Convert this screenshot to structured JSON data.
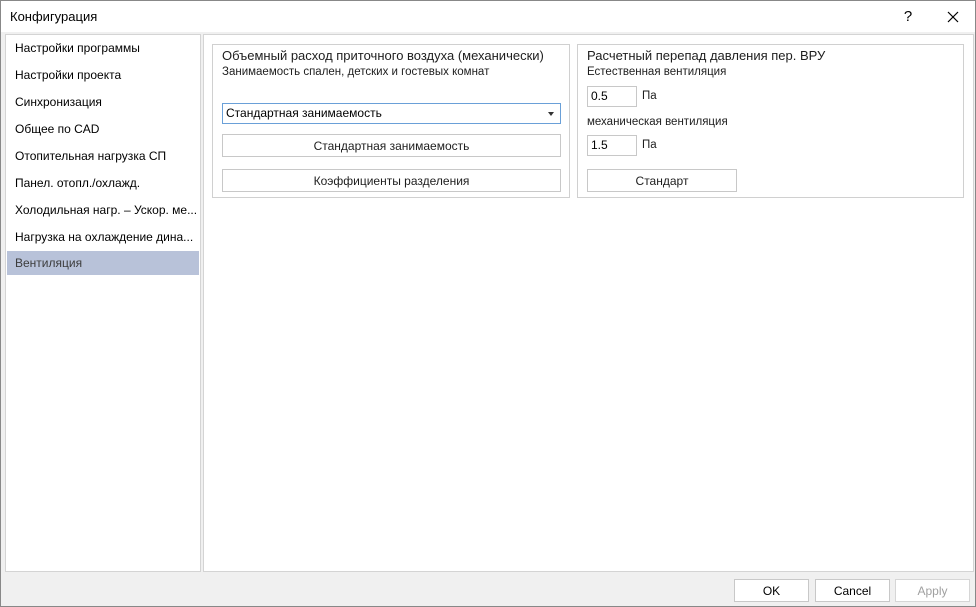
{
  "window": {
    "title": "Конфигурация",
    "help_label": "?"
  },
  "sidebar": {
    "items": [
      {
        "label": "Настройки программы",
        "selected": false
      },
      {
        "label": "Настройки проекта",
        "selected": false
      },
      {
        "label": "Синхронизация",
        "selected": false
      },
      {
        "label": "Общее по CAD",
        "selected": false
      },
      {
        "label": "Отопительная нагрузка СП",
        "selected": false
      },
      {
        "label": "Панел. отопл./охлажд.",
        "selected": false
      },
      {
        "label": "Холодильная нагр. – Ускор. ме...",
        "selected": false
      },
      {
        "label": "Нагрузка на охлаждение дина...",
        "selected": false
      },
      {
        "label": "Вентиляция",
        "selected": true
      }
    ]
  },
  "air_flow_group": {
    "title": "Объемный расход приточного воздуха (механически)",
    "subtitle": "Занимаемость спален, детских и гостевых комнат",
    "occupancy_select": {
      "value": "Стандартная занимаемость"
    },
    "standard_occupancy_button": "Стандартная занимаемость",
    "split_factors_button": "Коэффициенты разделения"
  },
  "pressure_group": {
    "title": "Расчетный перепад давления пер. ВРУ",
    "natural_label": "Естественная вентиляция",
    "natural_value": "0.5",
    "natural_unit": "Па",
    "mechanical_label": "механическая вентиляция",
    "mechanical_value": "1.5",
    "mechanical_unit": "Па",
    "standard_button": "Стандарт"
  },
  "footer": {
    "ok_label": "OK",
    "cancel_label": "Cancel",
    "apply_label": "Apply"
  },
  "colors": {
    "selected_bg": "#b8c2d9",
    "focus_border": "#6aa0d8"
  }
}
